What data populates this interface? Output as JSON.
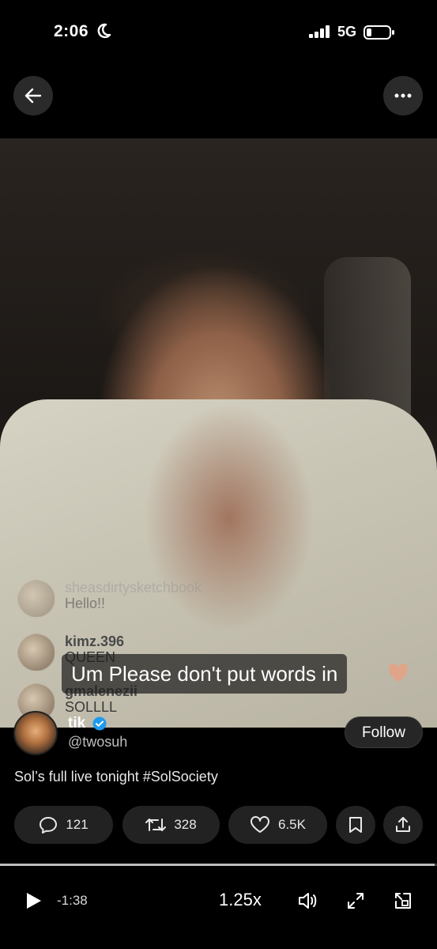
{
  "status_bar": {
    "time": "2:06",
    "network": "5G",
    "moon_icon": "moon-icon",
    "signal_icon": "signal-icon",
    "battery_icon": "battery-icon"
  },
  "top_bar": {
    "back_icon": "back-arrow-icon",
    "more_icon": "more-options-icon"
  },
  "live_comments": [
    {
      "user": "sheasdirtysketchbook",
      "message": "Hello!!"
    },
    {
      "user": "kimz.396",
      "message": "QUEEN"
    },
    {
      "user": "gmalenezii",
      "message": "SOLLLL"
    }
  ],
  "caption": "Um Please don't put words in",
  "author": {
    "name": "tik",
    "handle": "@twosuh",
    "verified": true,
    "follow_label": "Follow"
  },
  "tweet": {
    "text": "Sol’s full live tonight ",
    "hashtag": "#SolSociety"
  },
  "actions": {
    "replies": "121",
    "reposts": "328",
    "likes": "6.5K",
    "bookmark_icon": "bookmark-icon",
    "share_icon": "share-icon"
  },
  "player": {
    "progress": 0.995,
    "remaining": "-1:38",
    "speed": "1.25x",
    "play_icon": "play-icon",
    "volume_icon": "volume-icon",
    "fullscreen_icon": "fullscreen-icon",
    "pip_icon": "pip-icon"
  },
  "colors": {
    "background": "#000000",
    "pill": "#222222",
    "verified": "#1d9bf0"
  }
}
